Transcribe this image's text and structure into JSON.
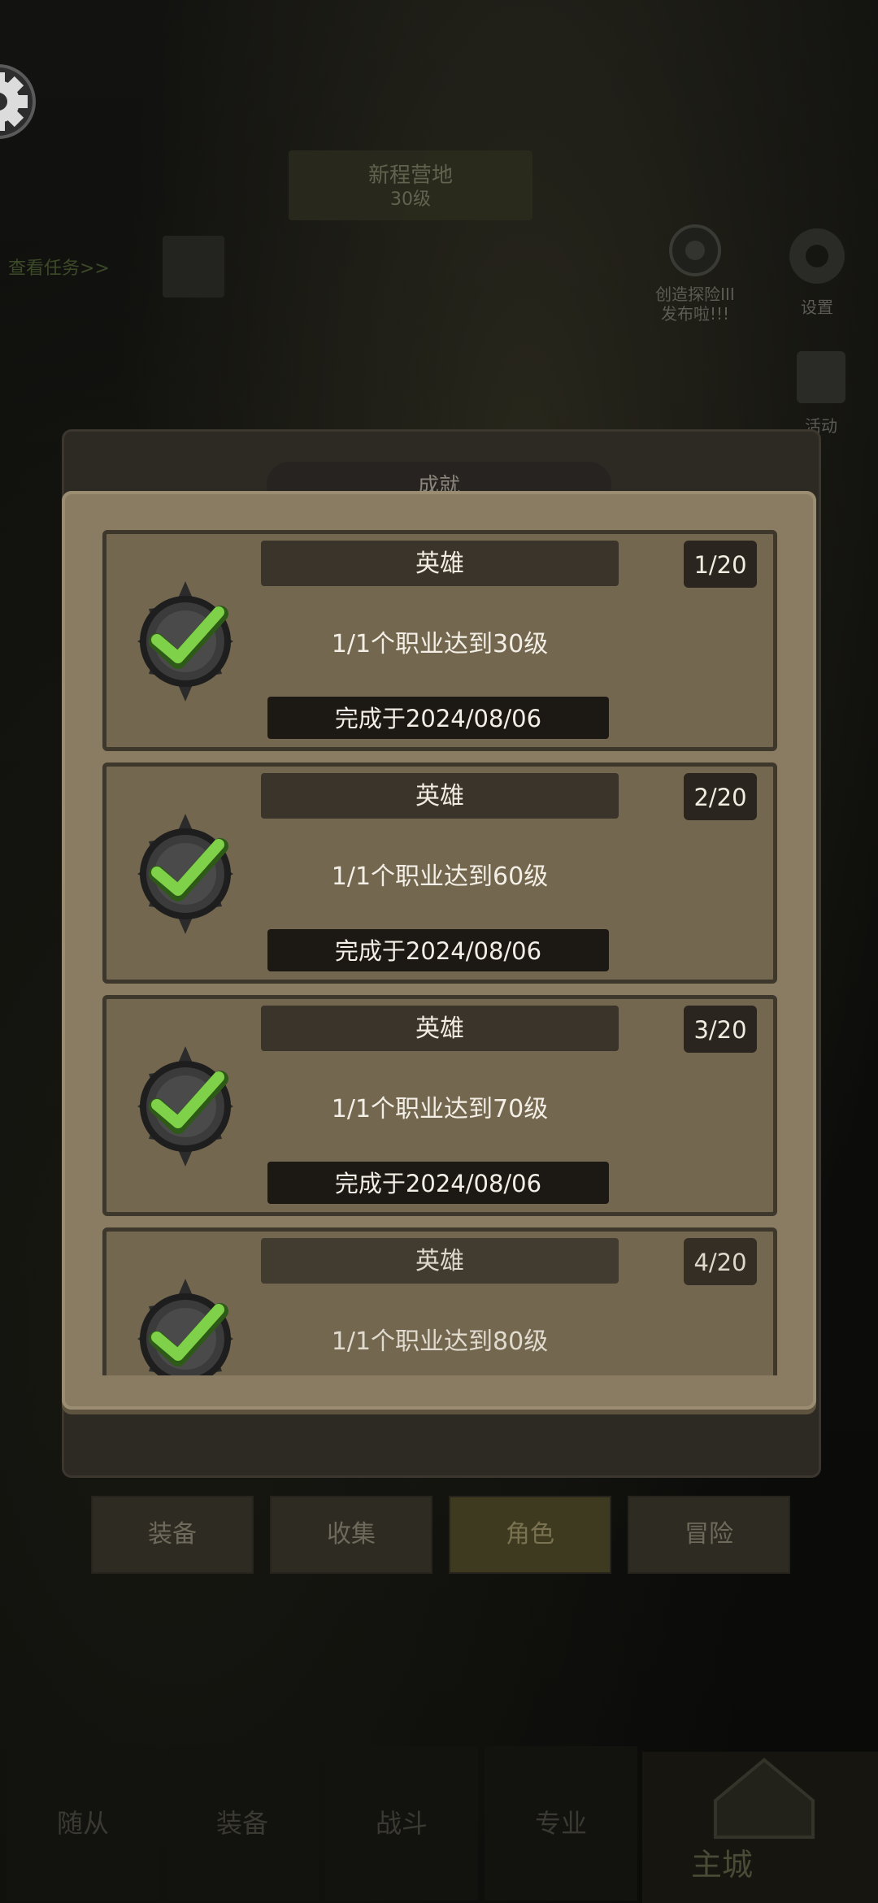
{
  "background": {
    "banner_line1": "新程营地",
    "banner_line2": "30级",
    "quest_link": "查看任务>>",
    "robot_label_line1": "创造探险III",
    "robot_label_line2": "发布啦!!!",
    "settings_label": "设置",
    "event_label": "活动",
    "panel_title": "成就",
    "tabs": [
      {
        "label": "装备",
        "active": false
      },
      {
        "label": "收集",
        "active": false
      },
      {
        "label": "角色",
        "active": true
      },
      {
        "label": "冒险",
        "active": false
      }
    ],
    "bottom_nav": [
      {
        "label": "随从"
      },
      {
        "label": "装备"
      },
      {
        "label": "战斗"
      },
      {
        "label": "专业"
      }
    ],
    "home_label": "主城"
  },
  "achievements": [
    {
      "title": "英雄",
      "count": "1/20",
      "description": "1/1个职业达到30级",
      "date": "完成于2024/08/06"
    },
    {
      "title": "英雄",
      "count": "2/20",
      "description": "1/1个职业达到60级",
      "date": "完成于2024/08/06"
    },
    {
      "title": "英雄",
      "count": "3/20",
      "description": "1/1个职业达到70级",
      "date": "完成于2024/08/06"
    },
    {
      "title": "英雄",
      "count": "4/20",
      "description": "1/1个职业达到80级",
      "date": ""
    }
  ],
  "colors": {
    "modal_bg": "#8a7c62",
    "card_bg": "#74674f",
    "check_green": "#7fd14a"
  },
  "icons": {
    "settings": "gear-icon",
    "badge": "checkmark-badge-icon"
  }
}
